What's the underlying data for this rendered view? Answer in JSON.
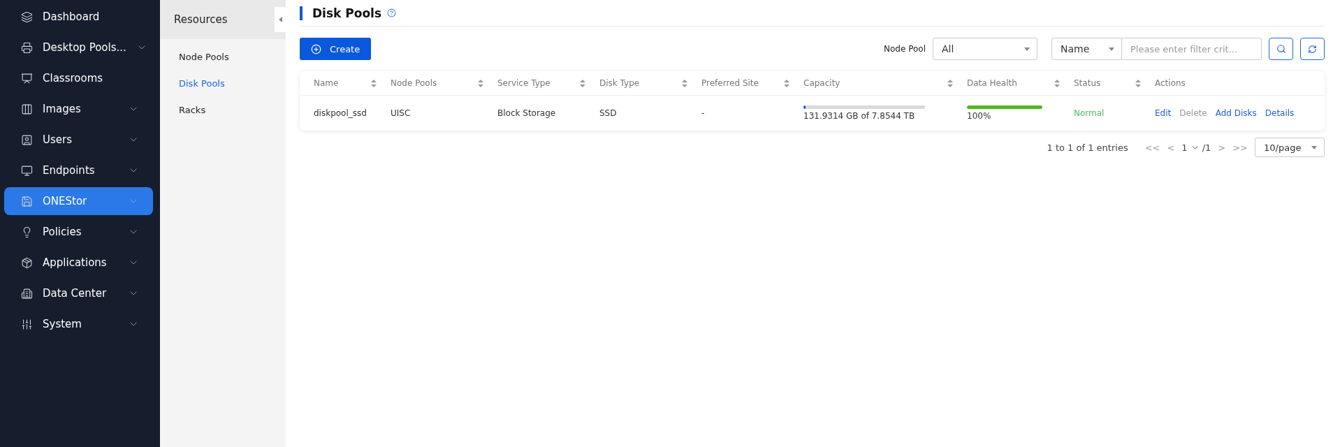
{
  "sidebar": {
    "items": [
      {
        "label": "Dashboard",
        "expandable": false,
        "selected": false
      },
      {
        "label": "Desktop Pools...",
        "expandable": true,
        "selected": false
      },
      {
        "label": "Classrooms",
        "expandable": false,
        "selected": false
      },
      {
        "label": "Images",
        "expandable": true,
        "selected": false
      },
      {
        "label": "Users",
        "expandable": true,
        "selected": false
      },
      {
        "label": "Endpoints",
        "expandable": true,
        "selected": false
      },
      {
        "label": "ONEStor",
        "expandable": true,
        "selected": true
      },
      {
        "label": "Policies",
        "expandable": true,
        "selected": false
      },
      {
        "label": "Applications",
        "expandable": true,
        "selected": false
      },
      {
        "label": "Data Center",
        "expandable": true,
        "selected": false
      },
      {
        "label": "System",
        "expandable": true,
        "selected": false
      }
    ]
  },
  "subnav": {
    "title": "Resources",
    "items": [
      {
        "label": "Node Pools",
        "selected": false
      },
      {
        "label": "Disk Pools",
        "selected": true
      },
      {
        "label": "Racks",
        "selected": false
      }
    ]
  },
  "page": {
    "title": "Disk Pools"
  },
  "toolbar": {
    "create_button": "Create",
    "node_pool_label": "Node Pool",
    "node_pool_value": "All",
    "filter_field": "Name",
    "filter_placeholder": "Please enter filter crit..."
  },
  "table": {
    "columns": [
      {
        "label": "Name",
        "sortable": true
      },
      {
        "label": "Node Pools",
        "sortable": true
      },
      {
        "label": "Service Type",
        "sortable": true
      },
      {
        "label": "Disk Type",
        "sortable": true
      },
      {
        "label": "Preferred Site",
        "sortable": true
      },
      {
        "label": "Capacity",
        "sortable": true
      },
      {
        "label": "Data Health",
        "sortable": true
      },
      {
        "label": "Status",
        "sortable": true
      },
      {
        "label": "Actions",
        "sortable": false
      }
    ],
    "rows": [
      {
        "name": "diskpool_ssd",
        "node_pools": "UISC",
        "service_type": "Block Storage",
        "disk_type": "SSD",
        "preferred_site": "-",
        "capacity": {
          "level": 0.02,
          "reading": "131.9314  GB  of  7.8544  TB"
        },
        "data_health": {
          "level": 1,
          "reading": "100%"
        },
        "status": {
          "label": "Normal",
          "color": "#52b96a"
        },
        "actions": [
          {
            "label": "Edit",
            "disabled": false
          },
          {
            "label": "Delete",
            "disabled": true
          },
          {
            "label": "Add  Disks",
            "disabled": false
          },
          {
            "label": "Details",
            "disabled": false
          }
        ]
      }
    ]
  },
  "pagination": {
    "summary": "1  to  1  of  1  entries",
    "first": "<<",
    "prev": "<",
    "page": "1",
    "total": "/1",
    "next": ">",
    "last": ">>",
    "page_size": "10/page"
  }
}
